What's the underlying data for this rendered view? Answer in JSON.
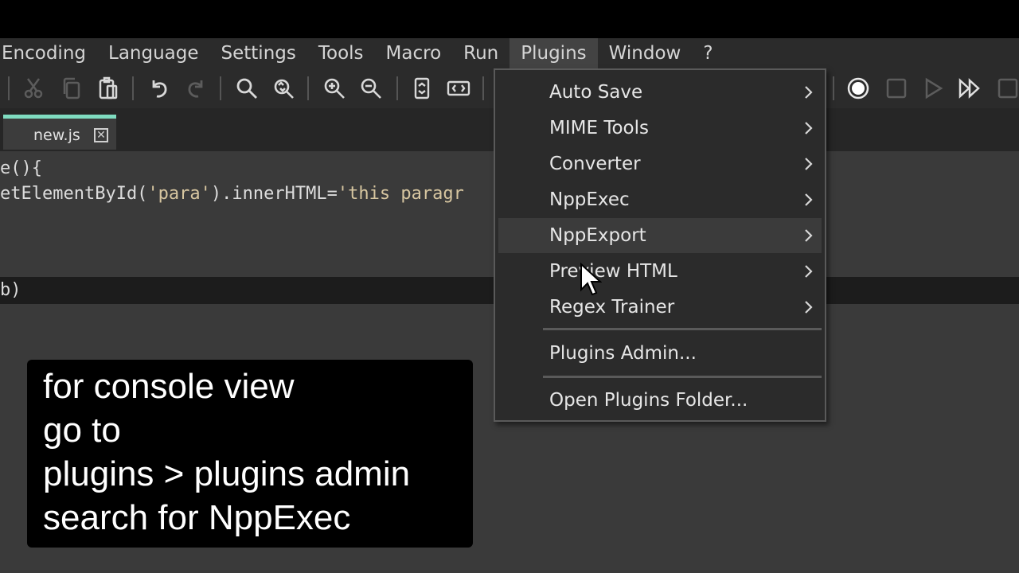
{
  "menubar": {
    "items": [
      "Encoding",
      "Language",
      "Settings",
      "Tools",
      "Macro",
      "Run",
      "Plugins",
      "Window",
      "?"
    ],
    "active": "Plugins"
  },
  "tabs": [
    {
      "label": "new.js",
      "close_glyph": "✕"
    }
  ],
  "editor": {
    "line1": "e(){",
    "line2_a": "etElementById(",
    "line2_b": "'para'",
    "line2_c": ").innerHTML=",
    "line2_d": "'this paragr",
    "line3": "b)"
  },
  "plugins_menu": {
    "items": [
      {
        "label": "Auto Save",
        "submenu": true
      },
      {
        "label": "MIME Tools",
        "submenu": true
      },
      {
        "label": "Converter",
        "submenu": true
      },
      {
        "label": "NppExec",
        "submenu": true
      },
      {
        "label": "NppExport",
        "submenu": true,
        "hovered": true
      },
      {
        "label": "Preview HTML",
        "submenu": true
      },
      {
        "label": "Regex Trainer",
        "submenu": true
      }
    ],
    "admin": "Plugins Admin...",
    "folder": "Open Plugins Folder..."
  },
  "caption": {
    "lines": [
      "for console view",
      "go to",
      "plugins > plugins admin",
      "search for NppExec"
    ]
  },
  "colors": {
    "tab_accent": "#7fdcc0",
    "menu_bg": "#2b2b2b",
    "editor_bg": "#3a3a3a"
  }
}
